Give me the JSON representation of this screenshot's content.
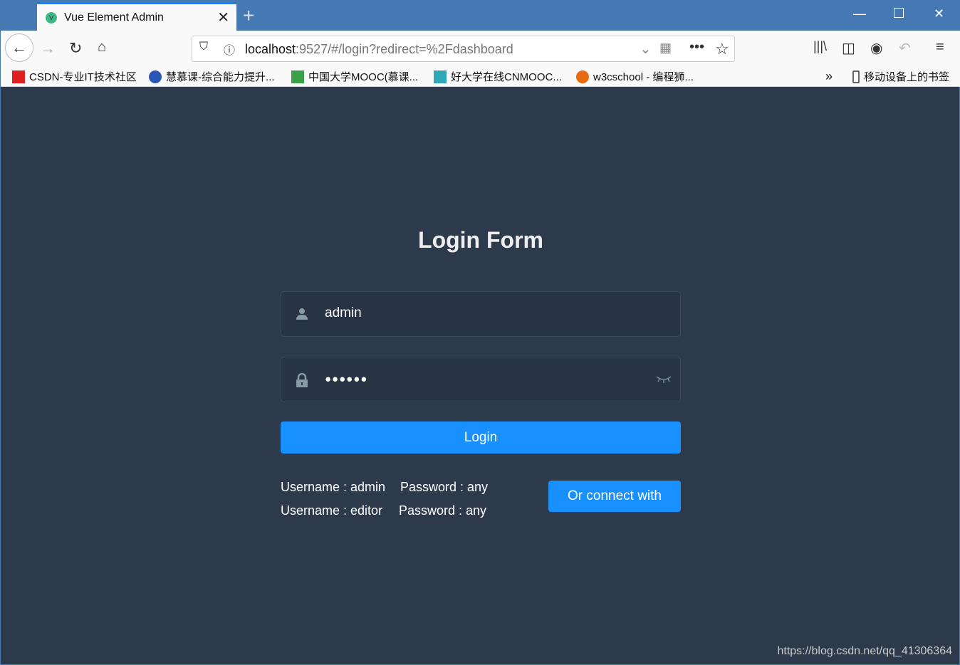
{
  "browser": {
    "tab_title": "Vue Element Admin",
    "tab_favicon": "V",
    "url_host": "localhost",
    "url_rest": ":9527/#/login?redirect=%2Fdashboard",
    "bookmarks": [
      {
        "label": "CSDN-专业IT技术社区",
        "color": "#e0201f"
      },
      {
        "label": "慧慕课-综合能力提升...",
        "color": "#2a56b5"
      },
      {
        "label": "中国大学MOOC(慕课...",
        "color": "#3aa14a"
      },
      {
        "label": "好大学在线CNMOOC...",
        "color": "#2fa9b8"
      },
      {
        "label": "w3cschool - 编程狮...",
        "color": "#e86a10"
      }
    ],
    "mobile_bookmarks": "移动设备上的书签"
  },
  "login": {
    "title": "Login Form",
    "username": "admin",
    "password_masked": "●●●●●●",
    "login_label": "Login",
    "tips": [
      {
        "user": "Username : admin",
        "pass": "Password : any"
      },
      {
        "user": "Username : editor",
        "pass": "Password : any"
      }
    ],
    "connect_label": "Or connect with",
    "accent": "#1890ff",
    "background": "#2d3a4b"
  },
  "watermark": "https://blog.csdn.net/qq_41306364"
}
